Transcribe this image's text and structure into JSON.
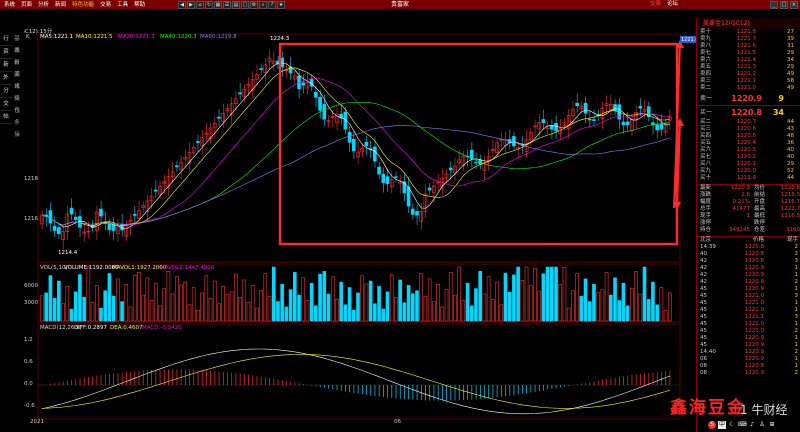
{
  "window": {
    "title": "贵富家"
  },
  "menu": [
    "系统",
    "页面",
    "分析",
    "新闻",
    "特色功能",
    "交易",
    "工具",
    "帮助"
  ],
  "menu_active_index": 4,
  "toolbar_icons": [
    "back-icon",
    "forward-icon",
    "home-icon",
    "refresh-icon",
    "grid-icon",
    "list-icon",
    "chart-icon",
    "window-icon",
    "settings-icon",
    "search-icon",
    "help-icon",
    "star-icon"
  ],
  "right_tabs": {
    "trade": "交易",
    "forum": "论坛"
  },
  "left_nav": [
    "行",
    "资",
    "新",
    "外",
    "分",
    "交",
    "帖"
  ],
  "side_nav": [
    "基本",
    "报价",
    "新闻",
    "资讯",
    "成交",
    "持仓",
    "代",
    "条",
    "操"
  ],
  "chart": {
    "ma_legend": {
      "prefix": "K",
      "ma5": "MA5:1221.1",
      "ma10": "MA10:1221.5",
      "ma20": "MA20:1221.3",
      "ma40": "MA40:1220.3",
      "ma60": "MA60:1219.8"
    },
    "code_label": "美黄金(GC12):15分",
    "peak_label": "1224.3",
    "low_label": "1214.4",
    "price_axis": [
      "1218",
      "1216"
    ],
    "vol_legend": {
      "a": "VOL(5,10)",
      "b": "VOLUME:1192.0000",
      "c": "MAVOL1:1927.2000",
      "d": "MAVOL2:1447.4000"
    },
    "vol_axis": [
      "6000",
      "3000"
    ],
    "macd_legend": {
      "a": "MACD(12,26,9)",
      "b": "DIFF:0.2897",
      "c": "DEA:0.4607",
      "d": "MACD:-0.3420"
    },
    "macd_axis": [
      "1.2",
      "0.6",
      "0.0",
      "-0.6"
    ],
    "date_labels": [
      "15分",
      "2021",
      "06"
    ],
    "current_price_tag": "1221.0"
  },
  "colors": {
    "up": "#ff3030",
    "down": "#00d8ff",
    "ma5": "#ffffff",
    "ma10": "#ffff00",
    "ma20": "#ff00ff",
    "ma40": "#00ff00",
    "ma60": "#8080ff",
    "box": "#ff2a2a",
    "bg": "#000000"
  },
  "quote": {
    "header": "美黄金12(GC12)",
    "asks": [
      {
        "l": "卖十",
        "p": "1221.8",
        "v": "27"
      },
      {
        "l": "卖九",
        "p": "1221.7",
        "v": "39"
      },
      {
        "l": "卖八",
        "p": "1221.6",
        "v": "31"
      },
      {
        "l": "卖七",
        "p": "1221.5",
        "v": "29"
      },
      {
        "l": "卖六",
        "p": "1221.4",
        "v": "34"
      },
      {
        "l": "卖五",
        "p": "1221.3",
        "v": "29"
      },
      {
        "l": "卖四",
        "p": "1221.2",
        "v": "49"
      },
      {
        "l": "卖三",
        "p": "1221.1",
        "v": "58"
      },
      {
        "l": "卖二",
        "p": "1221.0",
        "v": "49"
      }
    ],
    "ask1": {
      "l": "卖一",
      "p": "1220.9",
      "v": "9"
    },
    "bid1": {
      "l": "买一",
      "p": "1220.8",
      "v": "34"
    },
    "bids": [
      {
        "l": "买二",
        "p": "1220.7",
        "v": "44"
      },
      {
        "l": "买三",
        "p": "1220.6",
        "v": "43"
      },
      {
        "l": "买四",
        "p": "1220.5",
        "v": "48"
      },
      {
        "l": "买五",
        "p": "1220.4",
        "v": "36"
      },
      {
        "l": "买六",
        "p": "1220.3",
        "v": "40"
      },
      {
        "l": "买七",
        "p": "1220.2",
        "v": "40"
      },
      {
        "l": "买八",
        "p": "1220.1",
        "v": "29"
      },
      {
        "l": "买九",
        "p": "1220.0",
        "v": "52"
      },
      {
        "l": "买十",
        "p": "1219.9",
        "v": "44"
      }
    ],
    "stats": [
      {
        "a": "最新",
        "b": "1220.9",
        "c": "均价",
        "d": "1220.8"
      },
      {
        "a": "涨跌",
        "b": "2.6",
        "c": "前结",
        "d": "1218.3"
      },
      {
        "a": "幅度",
        "b": "0.21%",
        "c": "开盘",
        "d": "1216.7"
      },
      {
        "a": "总手",
        "b": "41477",
        "c": "最高",
        "d": "1222.7"
      },
      {
        "a": "现手",
        "b": "1",
        "c": "最低",
        "d": "1216.5"
      },
      {
        "a": "涨停",
        "b": "",
        "c": "跌停",
        "d": ""
      },
      {
        "a": "持仓",
        "b": "349245",
        "c": "仓差",
        "d": "3160"
      }
    ],
    "ticks_header": {
      "t": "北京",
      "p": "价格",
      "v": "现手"
    },
    "ticks": [
      {
        "t": "14:39",
        "p": "1220.8",
        "v": "2"
      },
      {
        "t": "40",
        "p": "1220.8",
        "v": "2"
      },
      {
        "t": "42",
        "p": "1220.8",
        "v": "3"
      },
      {
        "t": "42",
        "p": "1220.9",
        "v": "1"
      },
      {
        "t": "42",
        "p": "1220.9",
        "v": "1"
      },
      {
        "t": "42",
        "p": "1220.8",
        "v": "2"
      },
      {
        "t": "45",
        "p": "1220.9",
        "v": "1"
      },
      {
        "t": "45",
        "p": "1221.0",
        "v": "3"
      },
      {
        "t": "45",
        "p": "1221.0",
        "v": "1"
      },
      {
        "t": "45",
        "p": "1221.0",
        "v": "1"
      },
      {
        "t": "45",
        "p": "1221.1",
        "v": "3"
      },
      {
        "t": "45",
        "p": "1221.0",
        "v": "1"
      },
      {
        "t": "45",
        "p": "1221.0",
        "v": "2"
      },
      {
        "t": "45",
        "p": "1220.9",
        "v": "1"
      },
      {
        "t": "45",
        "p": "1220.9",
        "v": "1"
      },
      {
        "t": "14:40",
        "p": "1220.9",
        "v": "2"
      },
      {
        "t": "06",
        "p": "1220.9",
        "v": "1"
      },
      {
        "t": "08",
        "p": "1220.8",
        "v": "1"
      },
      {
        "t": "08",
        "p": "1220.9",
        "v": "2"
      }
    ]
  },
  "watermark": {
    "main": "鑫海豆金",
    "secondary": "1 牛财经"
  }
}
